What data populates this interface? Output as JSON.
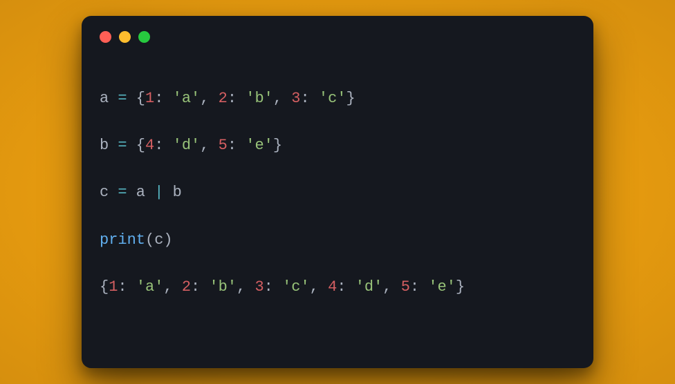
{
  "colors": {
    "background_outer": "#f4a818",
    "window_bg": "#15181f",
    "dot_close": "#ff5f56",
    "dot_minimize": "#ffbd2e",
    "dot_zoom": "#27c93f",
    "identifier": "#abb2bf",
    "operator": "#56b6c2",
    "punctuation": "#abb2bf",
    "number": "#d55f62",
    "string": "#98c379",
    "function_call": "#61afef"
  },
  "code": {
    "lines": [
      {
        "tokens": [
          {
            "cls": "tok-ident",
            "t": "a "
          },
          {
            "cls": "tok-op",
            "t": "="
          },
          {
            "cls": "tok-punct",
            "t": " {"
          },
          {
            "cls": "tok-num",
            "t": "1"
          },
          {
            "cls": "tok-punct",
            "t": ": "
          },
          {
            "cls": "tok-str",
            "t": "'a'"
          },
          {
            "cls": "tok-punct",
            "t": ", "
          },
          {
            "cls": "tok-num",
            "t": "2"
          },
          {
            "cls": "tok-punct",
            "t": ": "
          },
          {
            "cls": "tok-str",
            "t": "'b'"
          },
          {
            "cls": "tok-punct",
            "t": ", "
          },
          {
            "cls": "tok-num",
            "t": "3"
          },
          {
            "cls": "tok-punct",
            "t": ": "
          },
          {
            "cls": "tok-str",
            "t": "'c'"
          },
          {
            "cls": "tok-punct",
            "t": "}"
          }
        ]
      },
      {
        "tokens": [
          {
            "cls": "tok-ident",
            "t": "b "
          },
          {
            "cls": "tok-op",
            "t": "="
          },
          {
            "cls": "tok-punct",
            "t": " {"
          },
          {
            "cls": "tok-num",
            "t": "4"
          },
          {
            "cls": "tok-punct",
            "t": ": "
          },
          {
            "cls": "tok-str",
            "t": "'d'"
          },
          {
            "cls": "tok-punct",
            "t": ", "
          },
          {
            "cls": "tok-num",
            "t": "5"
          },
          {
            "cls": "tok-punct",
            "t": ": "
          },
          {
            "cls": "tok-str",
            "t": "'e'"
          },
          {
            "cls": "tok-punct",
            "t": "}"
          }
        ]
      },
      {
        "tokens": [
          {
            "cls": "tok-ident",
            "t": "c "
          },
          {
            "cls": "tok-op",
            "t": "="
          },
          {
            "cls": "tok-ident",
            "t": " a "
          },
          {
            "cls": "tok-op",
            "t": "|"
          },
          {
            "cls": "tok-ident",
            "t": " b"
          }
        ]
      },
      {
        "tokens": [
          {
            "cls": "tok-call",
            "t": "print"
          },
          {
            "cls": "tok-punct",
            "t": "(c)"
          }
        ]
      },
      {
        "tokens": [
          {
            "cls": "tok-punct",
            "t": "{"
          },
          {
            "cls": "tok-num",
            "t": "1"
          },
          {
            "cls": "tok-punct",
            "t": ": "
          },
          {
            "cls": "tok-str",
            "t": "'a'"
          },
          {
            "cls": "tok-punct",
            "t": ", "
          },
          {
            "cls": "tok-num",
            "t": "2"
          },
          {
            "cls": "tok-punct",
            "t": ": "
          },
          {
            "cls": "tok-str",
            "t": "'b'"
          },
          {
            "cls": "tok-punct",
            "t": ", "
          },
          {
            "cls": "tok-num",
            "t": "3"
          },
          {
            "cls": "tok-punct",
            "t": ": "
          },
          {
            "cls": "tok-str",
            "t": "'c'"
          },
          {
            "cls": "tok-punct",
            "t": ", "
          },
          {
            "cls": "tok-num",
            "t": "4"
          },
          {
            "cls": "tok-punct",
            "t": ": "
          },
          {
            "cls": "tok-str",
            "t": "'d'"
          },
          {
            "cls": "tok-punct",
            "t": ", "
          },
          {
            "cls": "tok-num",
            "t": "5"
          },
          {
            "cls": "tok-punct",
            "t": ": "
          },
          {
            "cls": "tok-str",
            "t": "'e'"
          },
          {
            "cls": "tok-punct",
            "t": "}"
          }
        ]
      }
    ]
  }
}
